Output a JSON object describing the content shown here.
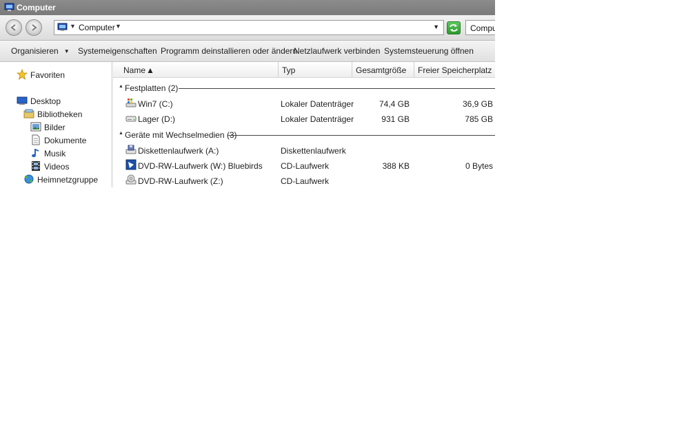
{
  "window": {
    "title": "Computer"
  },
  "address": {
    "crumb": "Computer",
    "search_text": "Comput"
  },
  "toolbar": {
    "items": [
      "Organisieren",
      "Systemeigenschaften",
      "Programm deinstallieren oder ändern",
      "Netzlaufwerk verbinden",
      "Systemsteuerung öffnen"
    ]
  },
  "sidebar": {
    "items": [
      {
        "label": "Favoriten",
        "icon": "star-icon"
      },
      {
        "label": "Desktop",
        "icon": "desktop-icon"
      },
      {
        "label": "Bibliotheken",
        "icon": "library-icon"
      },
      {
        "label": "Bilder",
        "icon": "pictures-icon"
      },
      {
        "label": "Dokumente",
        "icon": "document-icon"
      },
      {
        "label": "Musik",
        "icon": "music-icon"
      },
      {
        "label": "Videos",
        "icon": "video-icon"
      },
      {
        "label": "Heimnetzgruppe",
        "icon": "homegroup-icon"
      }
    ]
  },
  "columns": [
    "Name",
    "Typ",
    "Gesamtgröße",
    "Freier Speicherplatz"
  ],
  "groups": [
    {
      "label": "Festplatten (2)",
      "rows": [
        {
          "name": "Win7 (C:)",
          "type": "Lokaler Datenträger",
          "size": "74,4 GB",
          "free": "36,9 GB",
          "icon": "system-drive-icon"
        },
        {
          "name": "Lager (D:)",
          "type": "Lokaler Datenträger",
          "size": "931 GB",
          "free": "785 GB",
          "icon": "hard-drive-icon"
        }
      ]
    },
    {
      "label": "Geräte mit Wechselmedien (3)",
      "rows": [
        {
          "name": "Diskettenlaufwerk (A:)",
          "type": "Diskettenlaufwerk",
          "size": "",
          "free": "",
          "icon": "floppy-drive-icon"
        },
        {
          "name": "DVD-RW-Laufwerk (W:) Bluebirds",
          "type": "CD-Laufwerk",
          "size": "388 KB",
          "free": "0 Bytes",
          "icon": "dvd-disc-icon"
        },
        {
          "name": "DVD-RW-Laufwerk (Z:)",
          "type": "CD-Laufwerk",
          "size": "",
          "free": "",
          "icon": "dvd-drive-icon"
        }
      ]
    }
  ]
}
